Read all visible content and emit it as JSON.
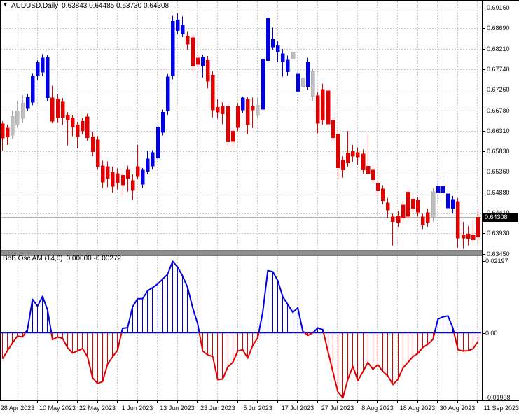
{
  "header": {
    "dropdown_icon": "▼",
    "symbol": "AUDUSD,Daily",
    "ohlc": "0.63843 0.64485 0.63730 0.64308"
  },
  "oscillator_header": {
    "title": "BoB Osc AM (14,0)",
    "values": "0.00000 -0.00272"
  },
  "price_axis": {
    "ticks": [
      "0.69160",
      "0.68690",
      "0.68210",
      "0.67740",
      "0.67260",
      "0.66780",
      "0.66310",
      "0.65830",
      "0.65360",
      "0.64880",
      "0.64410",
      "0.63930",
      "0.63450"
    ],
    "current_price_label": "0.64308"
  },
  "oscillator_axis": {
    "ticks": [
      {
        "label": "0.02197",
        "value": 0.02197
      },
      {
        "label": "0.00",
        "value": 0
      },
      {
        "label": "-0.01998",
        "value": -0.01998
      }
    ]
  },
  "time_axis": {
    "labels": [
      "28 Apr 2023",
      "10 May 2023",
      "22 May 2023",
      "1 Jun 2023",
      "13 Jun 2023",
      "23 Jun 2023",
      "5 Jul 2023",
      "17 Jul 2023",
      "27 Jul 2023",
      "8 Aug 2023",
      "18 Aug 2023",
      "30 Aug 2023",
      "11 Sep 2023"
    ]
  },
  "colors": {
    "bull": "#0000e2",
    "bear": "#e00000",
    "neutral": "#bfbfbf",
    "neutral_border": "#a8a8a8",
    "grid": "#c9c9c9",
    "zero_dotted": "#9a9a9a",
    "current_price_line": "#b0b0b0",
    "badge_bg": "#000000",
    "badge_text": "#ffffff",
    "border": "#000000",
    "separator": "#8f8f8f"
  },
  "chart_data": [
    {
      "type": "candlestick",
      "title": "AUDUSD,Daily",
      "ohlc_display": {
        "open": 0.63843,
        "high": 0.64485,
        "low": 0.6373,
        "close": 0.64308
      },
      "current_price": 0.64308,
      "ylim": [
        0.6345,
        0.6916
      ],
      "y_ticks": [
        0.6916,
        0.6869,
        0.6821,
        0.6774,
        0.6726,
        0.6678,
        0.6631,
        0.6583,
        0.6536,
        0.6488,
        0.6441,
        0.6393,
        0.6345
      ],
      "x_labels": [
        "28 Apr 2023",
        "10 May 2023",
        "22 May 2023",
        "1 Jun 2023",
        "13 Jun 2023",
        "23 Jun 2023",
        "5 Jul 2023",
        "17 Jul 2023",
        "27 Jul 2023",
        "8 Aug 2023",
        "18 Aug 2023",
        "30 Aug 2023",
        "11 Sep 2023"
      ],
      "bar_colors_legend": {
        "b": "bull-blue",
        "r": "bear-red",
        "s": "neutral-gray"
      },
      "bars": [
        [
          0.6647,
          0.6653,
          0.6585,
          0.6614,
          "r"
        ],
        [
          0.6637,
          0.6645,
          0.6598,
          0.6616,
          "r"
        ],
        [
          0.662,
          0.6678,
          0.6612,
          0.6665,
          "s"
        ],
        [
          0.6645,
          0.67,
          0.6638,
          0.6677,
          "s"
        ],
        [
          0.6659,
          0.6713,
          0.665,
          0.6695,
          "s"
        ],
        [
          0.6684,
          0.6716,
          0.6676,
          0.6708,
          "b"
        ],
        [
          0.6697,
          0.6763,
          0.669,
          0.6757,
          "b"
        ],
        [
          0.6759,
          0.6794,
          0.6748,
          0.6789,
          "b"
        ],
        [
          0.6766,
          0.6808,
          0.6757,
          0.68,
          "b"
        ],
        [
          0.6707,
          0.6806,
          0.67,
          0.6801,
          "b"
        ],
        [
          0.6707,
          0.6735,
          0.6648,
          0.6653,
          "r"
        ],
        [
          0.6704,
          0.6715,
          0.665,
          0.6662,
          "r"
        ],
        [
          0.6699,
          0.6707,
          0.6644,
          0.6662,
          "r"
        ],
        [
          0.6667,
          0.6674,
          0.6597,
          0.6655,
          "r"
        ],
        [
          0.6661,
          0.6668,
          0.6618,
          0.664,
          "r"
        ],
        [
          0.6645,
          0.6652,
          0.659,
          0.6617,
          "r"
        ],
        [
          0.6653,
          0.6661,
          0.6622,
          0.663,
          "r"
        ],
        [
          0.6663,
          0.667,
          0.6608,
          0.6615,
          "r"
        ],
        [
          0.6617,
          0.6629,
          0.6572,
          0.6582,
          "r"
        ],
        [
          0.661,
          0.6619,
          0.6541,
          0.6548,
          "r"
        ],
        [
          0.655,
          0.6562,
          0.6498,
          0.6512,
          "r"
        ],
        [
          0.6548,
          0.656,
          0.65,
          0.6521,
          "r"
        ],
        [
          0.6535,
          0.6548,
          0.6488,
          0.6502,
          "r"
        ],
        [
          0.6532,
          0.6544,
          0.6495,
          0.651,
          "r"
        ],
        [
          0.6528,
          0.6538,
          0.648,
          0.6505,
          "r"
        ],
        [
          0.654,
          0.655,
          0.649,
          0.652,
          "r"
        ],
        [
          0.6516,
          0.653,
          0.6471,
          0.6492,
          "r"
        ],
        [
          0.6548,
          0.6598,
          0.6518,
          0.6525,
          "r"
        ],
        [
          0.6507,
          0.6545,
          0.6498,
          0.654,
          "b"
        ],
        [
          0.6537,
          0.6584,
          0.653,
          0.6566,
          "b"
        ],
        [
          0.6549,
          0.6586,
          0.6541,
          0.6581,
          "b"
        ],
        [
          0.6568,
          0.6645,
          0.656,
          0.664,
          "b"
        ],
        [
          0.6627,
          0.668,
          0.662,
          0.6674,
          "b"
        ],
        [
          0.6676,
          0.6762,
          0.6668,
          0.6756,
          "b"
        ],
        [
          0.6758,
          0.6897,
          0.675,
          0.6885,
          "b"
        ],
        [
          0.6863,
          0.6903,
          0.6855,
          0.6888,
          "b"
        ],
        [
          0.6855,
          0.6896,
          0.6848,
          0.6876,
          "b"
        ],
        [
          0.6851,
          0.686,
          0.6818,
          0.6831,
          "r"
        ],
        [
          0.6847,
          0.6854,
          0.6766,
          0.678,
          "r"
        ],
        [
          0.68,
          0.6811,
          0.6772,
          0.6784,
          "r"
        ],
        [
          0.6782,
          0.6807,
          0.6754,
          0.6801,
          "b"
        ],
        [
          0.6794,
          0.6804,
          0.6729,
          0.6745,
          "r"
        ],
        [
          0.676,
          0.6769,
          0.6662,
          0.6679,
          "r"
        ],
        [
          0.6685,
          0.6704,
          0.6659,
          0.6674,
          "r"
        ],
        [
          0.6687,
          0.6697,
          0.6646,
          0.667,
          "r"
        ],
        [
          0.6687,
          0.6693,
          0.6594,
          0.6605,
          "r"
        ],
        [
          0.663,
          0.6641,
          0.6588,
          0.6606,
          "r"
        ],
        [
          0.6687,
          0.6695,
          0.663,
          0.6638,
          "r"
        ],
        [
          0.6679,
          0.671,
          0.6672,
          0.6707,
          "b"
        ],
        [
          0.6703,
          0.671,
          0.6622,
          0.6645,
          "r"
        ],
        [
          0.6687,
          0.6708,
          0.6637,
          0.6679,
          "r"
        ],
        [
          0.669,
          0.6707,
          0.666,
          0.6667,
          "s"
        ],
        [
          0.668,
          0.68,
          0.6672,
          0.6796,
          "b"
        ],
        [
          0.6793,
          0.6903,
          0.6788,
          0.6892,
          "b"
        ],
        [
          0.6825,
          0.687,
          0.6818,
          0.6843,
          "b"
        ],
        [
          0.6813,
          0.6838,
          0.679,
          0.6828,
          "b"
        ],
        [
          0.6791,
          0.682,
          0.6756,
          0.6809,
          "b"
        ],
        [
          0.6767,
          0.6805,
          0.6758,
          0.6795,
          "b"
        ],
        [
          0.6812,
          0.6848,
          0.6739,
          0.6796,
          "s"
        ],
        [
          0.6722,
          0.6772,
          0.6712,
          0.6762,
          "b"
        ],
        [
          0.6753,
          0.676,
          0.6714,
          0.6733,
          "s"
        ],
        [
          0.6733,
          0.68,
          0.6725,
          0.6791,
          "b"
        ],
        [
          0.6768,
          0.6775,
          0.67,
          0.671,
          "s"
        ],
        [
          0.6712,
          0.672,
          0.6625,
          0.6648,
          "r"
        ],
        [
          0.6727,
          0.674,
          0.6645,
          0.6655,
          "r"
        ],
        [
          0.6723,
          0.673,
          0.6638,
          0.6646,
          "r"
        ],
        [
          0.6655,
          0.6663,
          0.6603,
          0.6615,
          "r"
        ],
        [
          0.6623,
          0.6632,
          0.652,
          0.6545,
          "r"
        ],
        [
          0.6563,
          0.6572,
          0.6522,
          0.654,
          "r"
        ],
        [
          0.658,
          0.663,
          0.6548,
          0.6556,
          "r"
        ],
        [
          0.6583,
          0.6598,
          0.6558,
          0.6572,
          "r"
        ],
        [
          0.6581,
          0.6592,
          0.6552,
          0.657,
          "r"
        ],
        [
          0.6577,
          0.6588,
          0.6532,
          0.654,
          "r"
        ],
        [
          0.6549,
          0.6622,
          0.6525,
          0.6532,
          "r"
        ],
        [
          0.654,
          0.655,
          0.651,
          0.6517,
          "r"
        ],
        [
          0.6509,
          0.652,
          0.6482,
          0.6491,
          "r"
        ],
        [
          0.6496,
          0.6505,
          0.646,
          0.6469,
          "r"
        ],
        [
          0.6464,
          0.6475,
          0.6428,
          0.6447,
          "r"
        ],
        [
          0.6431,
          0.644,
          0.6365,
          0.642,
          "r"
        ],
        [
          0.6434,
          0.6445,
          0.6408,
          0.6418,
          "r"
        ],
        [
          0.6459,
          0.6468,
          0.642,
          0.6428,
          "r"
        ],
        [
          0.6489,
          0.6497,
          0.6425,
          0.6432,
          "r"
        ],
        [
          0.6473,
          0.6482,
          0.644,
          0.6451,
          "r"
        ],
        [
          0.647,
          0.6478,
          0.6432,
          0.6442,
          "r"
        ],
        [
          0.6431,
          0.644,
          0.6403,
          0.6412,
          "r"
        ],
        [
          0.6441,
          0.645,
          0.6408,
          0.6418,
          "r"
        ],
        [
          0.649,
          0.6498,
          0.642,
          0.643,
          "s"
        ],
        [
          0.6487,
          0.6524,
          0.6478,
          0.6503,
          "b"
        ],
        [
          0.6488,
          0.652,
          0.648,
          0.6502,
          "b"
        ],
        [
          0.6452,
          0.6495,
          0.6445,
          0.6485,
          "b"
        ],
        [
          0.6451,
          0.648,
          0.644,
          0.6472,
          "b"
        ],
        [
          0.6467,
          0.6475,
          0.636,
          0.6382,
          "r"
        ],
        [
          0.639,
          0.642,
          0.6357,
          0.6382,
          "r"
        ],
        [
          0.6392,
          0.641,
          0.6365,
          0.638,
          "r"
        ],
        [
          0.639,
          0.6422,
          0.6368,
          0.6378,
          "r"
        ],
        [
          0.63843,
          0.64485,
          0.6373,
          0.64308,
          "r"
        ]
      ]
    },
    {
      "type": "line",
      "title": "BoB Osc AM (14,0)",
      "subtitle_values": [
        0.0,
        -0.00272
      ],
      "ylim": [
        -0.01998,
        0.02197
      ],
      "y_ticks": [
        0.02197,
        0.0,
        -0.01998
      ],
      "zero_line": 0.0,
      "legend_position": "none",
      "current_value": -0.00272,
      "values": [
        -0.008,
        -0.0055,
        -0.0031,
        -0.001,
        -0.0013,
        0.001,
        0.0103,
        0.0082,
        0.0112,
        0.0071,
        -0.0021,
        -0.0013,
        -0.0017,
        -0.0046,
        -0.0062,
        -0.0056,
        -0.0048,
        -0.0074,
        -0.0138,
        -0.0156,
        -0.015,
        -0.0096,
        -0.0074,
        -0.0053,
        0.0014,
        0.0016,
        0.008,
        0.0105,
        0.0105,
        0.0129,
        0.0139,
        0.015,
        0.0165,
        0.018,
        0.02197,
        0.0202,
        0.0174,
        0.0139,
        0.0077,
        0.0028,
        -0.0056,
        -0.0068,
        -0.0073,
        -0.0144,
        -0.0142,
        -0.0105,
        -0.0091,
        -0.0056,
        -0.0052,
        -0.0078,
        -0.0038,
        -0.0015,
        0.0063,
        0.0191,
        0.0188,
        0.016,
        0.0111,
        0.0087,
        0.0063,
        0.0077,
        0.0005,
        -0.0008,
        0.0,
        0.0015,
        0.001,
        -0.0056,
        -0.0119,
        -0.0181,
        -0.01998,
        -0.0143,
        -0.0103,
        -0.0147,
        -0.012,
        -0.0091,
        -0.0112,
        -0.0098,
        -0.0119,
        -0.0133,
        -0.0159,
        -0.0143,
        -0.0108,
        -0.0091,
        -0.0073,
        -0.0063,
        -0.0045,
        -0.0035,
        -0.002,
        0.0042,
        0.0049,
        0.0052,
        0.0014,
        -0.0052,
        -0.0056,
        -0.0055,
        -0.0049,
        -0.00272
      ]
    }
  ]
}
